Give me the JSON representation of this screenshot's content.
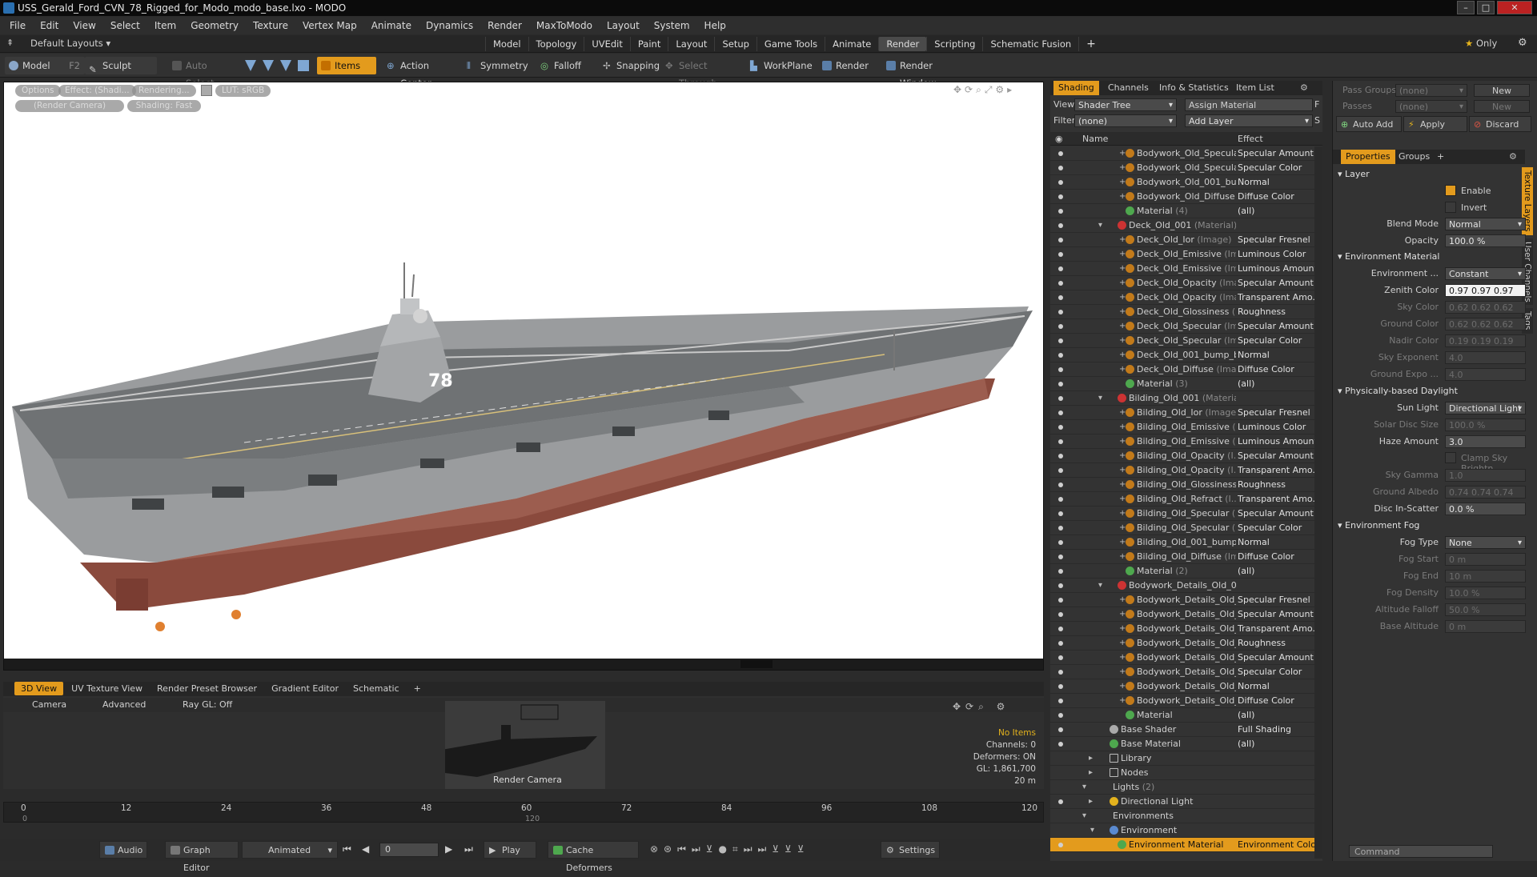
{
  "title": "USS_Gerald_Ford_CVN_78_Rigged_for_Modo_modo_base.lxo - MODO",
  "menu": [
    "File",
    "Edit",
    "View",
    "Select",
    "Item",
    "Geometry",
    "Texture",
    "Vertex Map",
    "Animate",
    "Dynamics",
    "Render",
    "MaxToModo",
    "Layout",
    "System",
    "Help"
  ],
  "layout_selector": "Default Layouts",
  "layout_tabs": [
    "Model",
    "Topology",
    "UVEdit",
    "Paint",
    "Layout",
    "Setup",
    "Game Tools",
    "Animate",
    "Render",
    "Scripting",
    "Schematic Fusion"
  ],
  "layout_plus": "+",
  "only_label": "Only",
  "toolbar": {
    "model": "Model",
    "model_key": "F2",
    "sculpt": "Sculpt",
    "auto_select": "Auto Select",
    "items": "Items",
    "action_center": "Action Center",
    "symmetry": "Symmetry",
    "falloff": "Falloff",
    "snapping": "Snapping",
    "select_through": "Select Through",
    "workplane": "WorkPlane",
    "render": "Render",
    "render_window": "Render Window"
  },
  "viewport": {
    "options": "Options",
    "effect": "Effect: (Shadi...",
    "rendering": "Rendering...",
    "lut": "LUT: sRGB",
    "render_camera": "(Render Camera)",
    "shading": "Shading: Fast",
    "hull_number": "78"
  },
  "bottom_tabs": [
    "3D View",
    "UV Texture View",
    "Render Preset Browser",
    "Gradient Editor",
    "Schematic"
  ],
  "bottom_bar": {
    "camera": "Camera",
    "advanced": "Advanced",
    "raygl": "Ray GL: Off"
  },
  "preview": {
    "label": "Render Camera",
    "no_items": "No Items",
    "channels": "Channels: 0",
    "deformers": "Deformers: ON",
    "gl": "GL: 1,861,700",
    "scale": "20 m"
  },
  "timeline": {
    "ticks": [
      "0",
      "12",
      "24",
      "36",
      "48",
      "60",
      "72",
      "84",
      "96",
      "108",
      "120"
    ],
    "sub_ticks": [
      "0",
      "120"
    ]
  },
  "transport": {
    "audio": "Audio",
    "graph_editor": "Graph Editor",
    "animated": "Animated",
    "frame": "0",
    "play": "Play",
    "cache": "Cache Deformers",
    "settings": "Settings"
  },
  "shader": {
    "tabs": [
      "Shading",
      "Channels",
      "Info & Statistics",
      "Item List"
    ],
    "view_label": "View",
    "view_value": "Shader Tree",
    "assign": "Assign Material",
    "filter_label": "Filter",
    "filter_value": "(none)",
    "add_layer": "Add Layer",
    "f_btn": "F",
    "s_btn": "S",
    "col_name": "Name",
    "col_effect": "Effect",
    "rows": [
      {
        "name": "Bodywork_Old_Specula...",
        "sub": "",
        "effect": "Specular Amount",
        "kind": "img",
        "indent": 3
      },
      {
        "name": "Bodywork_Old_Specula...",
        "sub": "",
        "effect": "Specular Color",
        "kind": "img",
        "indent": 3
      },
      {
        "name": "Bodywork_Old_001_bu...",
        "sub": "",
        "effect": "Normal",
        "kind": "img",
        "indent": 3
      },
      {
        "name": "Bodywork_Old_Diffuse",
        "sub": "",
        "effect": "Diffuse Color",
        "kind": "img",
        "indent": 3
      },
      {
        "name": "Material",
        "sub": "(4)",
        "effect": "(all)",
        "kind": "mat",
        "indent": 3
      },
      {
        "name": "Deck_Old_001",
        "sub": "(Material)",
        "effect": "",
        "kind": "grp",
        "indent": 2
      },
      {
        "name": "Deck_Old_Ior",
        "sub": "(Image)",
        "effect": "Specular Fresnel",
        "kind": "img",
        "indent": 3
      },
      {
        "name": "Deck_Old_Emissive",
        "sub": "(Im...",
        "effect": "Luminous Color",
        "kind": "img",
        "indent": 3
      },
      {
        "name": "Deck_Old_Emissive",
        "sub": "(Im...",
        "effect": "Luminous Amount",
        "kind": "img",
        "indent": 3
      },
      {
        "name": "Deck_Old_Opacity",
        "sub": "(Ima...",
        "effect": "Specular Amount",
        "kind": "img",
        "indent": 3
      },
      {
        "name": "Deck_Old_Opacity",
        "sub": "(Ima...",
        "effect": "Transparent Amo...",
        "kind": "img",
        "indent": 3
      },
      {
        "name": "Deck_Old_Glossiness",
        "sub": "(I...",
        "effect": "Roughness",
        "kind": "img",
        "indent": 3
      },
      {
        "name": "Deck_Old_Specular",
        "sub": "(Im...",
        "effect": "Specular Amount",
        "kind": "img",
        "indent": 3
      },
      {
        "name": "Deck_Old_Specular",
        "sub": "(Im...",
        "effect": "Specular Color",
        "kind": "img",
        "indent": 3
      },
      {
        "name": "Deck_Old_001_bump_b...",
        "sub": "",
        "effect": "Normal",
        "kind": "img",
        "indent": 3
      },
      {
        "name": "Deck_Old_Diffuse",
        "sub": "(Ima...",
        "effect": "Diffuse Color",
        "kind": "img",
        "indent": 3
      },
      {
        "name": "Material",
        "sub": "(3)",
        "effect": "(all)",
        "kind": "mat",
        "indent": 3
      },
      {
        "name": "Bilding_Old_001",
        "sub": "(Material)",
        "effect": "",
        "kind": "grp",
        "indent": 2
      },
      {
        "name": "Bilding_Old_Ior",
        "sub": "(Image)",
        "effect": "Specular Fresnel",
        "kind": "img",
        "indent": 3
      },
      {
        "name": "Bilding_Old_Emissive",
        "sub": "(I...",
        "effect": "Luminous Color",
        "kind": "img",
        "indent": 3
      },
      {
        "name": "Bilding_Old_Emissive",
        "sub": "(I...",
        "effect": "Luminous Amount",
        "kind": "img",
        "indent": 3
      },
      {
        "name": "Bilding_Old_Opacity",
        "sub": "(I...",
        "effect": "Specular Amount",
        "kind": "img",
        "indent": 3
      },
      {
        "name": "Bilding_Old_Opacity",
        "sub": "(I...",
        "effect": "Transparent Amo...",
        "kind": "img",
        "indent": 3
      },
      {
        "name": "Bilding_Old_Glossiness",
        "sub": "",
        "effect": "Roughness",
        "kind": "img",
        "indent": 3
      },
      {
        "name": "Bilding_Old_Refract",
        "sub": "(I...",
        "effect": "Transparent Amo...",
        "kind": "img",
        "indent": 3
      },
      {
        "name": "Bilding_Old_Specular",
        "sub": "(I...",
        "effect": "Specular Amount",
        "kind": "img",
        "indent": 3
      },
      {
        "name": "Bilding_Old_Specular",
        "sub": "(I...",
        "effect": "Specular Color",
        "kind": "img",
        "indent": 3
      },
      {
        "name": "Bilding_Old_001_bump",
        "sub": "...",
        "effect": "Normal",
        "kind": "img",
        "indent": 3
      },
      {
        "name": "Bilding_Old_Diffuse",
        "sub": "(Im...",
        "effect": "Diffuse Color",
        "kind": "img",
        "indent": 3
      },
      {
        "name": "Material",
        "sub": "(2)",
        "effect": "(all)",
        "kind": "mat",
        "indent": 3
      },
      {
        "name": "Bodywork_Details_Old_00...",
        "sub": "",
        "effect": "",
        "kind": "grp",
        "indent": 2
      },
      {
        "name": "Bodywork_Details_Old_...",
        "sub": "",
        "effect": "Specular Fresnel",
        "kind": "img",
        "indent": 3
      },
      {
        "name": "Bodywork_Details_Old_...",
        "sub": "",
        "effect": "Specular Amount",
        "kind": "img",
        "indent": 3
      },
      {
        "name": "Bodywork_Details_Old_...",
        "sub": "",
        "effect": "Transparent Amo...",
        "kind": "img",
        "indent": 3
      },
      {
        "name": "Bodywork_Details_Old_...",
        "sub": "",
        "effect": "Roughness",
        "kind": "img",
        "indent": 3
      },
      {
        "name": "Bodywork_Details_Old_...",
        "sub": "",
        "effect": "Specular Amount",
        "kind": "img",
        "indent": 3
      },
      {
        "name": "Bodywork_Details_Old_...",
        "sub": "",
        "effect": "Specular Color",
        "kind": "img",
        "indent": 3
      },
      {
        "name": "Bodywork_Details_Old_...",
        "sub": "",
        "effect": "Normal",
        "kind": "img",
        "indent": 3
      },
      {
        "name": "Bodywork_Details_Old_...",
        "sub": "",
        "effect": "Diffuse Color",
        "kind": "img",
        "indent": 3
      },
      {
        "name": "Material",
        "sub": "",
        "effect": "(all)",
        "kind": "mat",
        "indent": 3
      },
      {
        "name": "Base Shader",
        "sub": "",
        "effect": "Full Shading",
        "kind": "shader",
        "indent": 1
      },
      {
        "name": "Base Material",
        "sub": "",
        "effect": "(all)",
        "kind": "mat",
        "indent": 1
      },
      {
        "name": "Library",
        "sub": "",
        "effect": "",
        "kind": "folder",
        "indent": 1
      },
      {
        "name": "Nodes",
        "sub": "",
        "effect": "",
        "kind": "folder",
        "indent": 1
      },
      {
        "name": "Lights",
        "sub": "(2)",
        "effect": "",
        "kind": "plain",
        "indent": 0
      },
      {
        "name": "Directional Light",
        "sub": "",
        "effect": "",
        "kind": "light",
        "indent": 1
      },
      {
        "name": "Environments",
        "sub": "",
        "effect": "",
        "kind": "plain",
        "indent": 0
      },
      {
        "name": "Environment",
        "sub": "",
        "effect": "",
        "kind": "env",
        "indent": 1
      },
      {
        "name": "Environment Material",
        "sub": "",
        "effect": "Environment Color",
        "kind": "envmat",
        "indent": 2
      }
    ]
  },
  "props": {
    "pass_groups_label": "Pass Groups",
    "pass_groups_value": "(none)",
    "new": "New",
    "passes_label": "Passes",
    "passes_value": "(none)",
    "auto_add": "Auto Add",
    "apply": "Apply",
    "discard": "Discard",
    "tabs": [
      "Properties",
      "Groups"
    ],
    "side_tabs": [
      "Texture Layers",
      "User Channels",
      "Tags"
    ],
    "layer": "Layer",
    "enable": "Enable",
    "invert": "Invert",
    "blend_mode_label": "Blend Mode",
    "blend_mode": "Normal",
    "opacity_label": "Opacity",
    "opacity": "100.0 %",
    "env_material": "Environment Material",
    "environment_label": "Environment ...",
    "environment": "Constant",
    "zenith_label": "Zenith Color",
    "zenith": "0.97  0.97  0.97",
    "sky_label": "Sky Color",
    "sky": "0.62  0.62  0.62",
    "ground_label": "Ground Color",
    "ground": "0.62  0.62  0.62",
    "nadir_label": "Nadir Color",
    "nadir": "0.19  0.19  0.19",
    "sky_exp_label": "Sky Exponent",
    "sky_exp": "4.0",
    "ground_exp_label": "Ground Expo ...",
    "ground_exp": "4.0",
    "pbd": "Physically-based Daylight",
    "sun_label": "Sun Light",
    "sun": "Directional Light",
    "solar_label": "Solar Disc Size",
    "solar": "100.0 %",
    "haze_label": "Haze Amount",
    "haze": "3.0",
    "clamp": "Clamp Sky Brightn ...",
    "gamma_label": "Sky Gamma",
    "gamma": "1.0",
    "albedo_label": "Ground Albedo",
    "albedo": "0.74  0.74  0.74",
    "disc_label": "Disc In-Scatter",
    "disc": "0.0 %",
    "fog": "Environment Fog",
    "fogtype_label": "Fog Type",
    "fogtype": "None",
    "fogstart_label": "Fog Start",
    "fogstart": "0 m",
    "fogend_label": "Fog End",
    "fogend": "10 m",
    "fogdens_label": "Fog Density",
    "fogdens": "10.0 %",
    "altfall_label": "Altitude Falloff",
    "altfall": "50.0 %",
    "basealt_label": "Base Altitude",
    "basealt": "0 m",
    "command": "Command"
  }
}
